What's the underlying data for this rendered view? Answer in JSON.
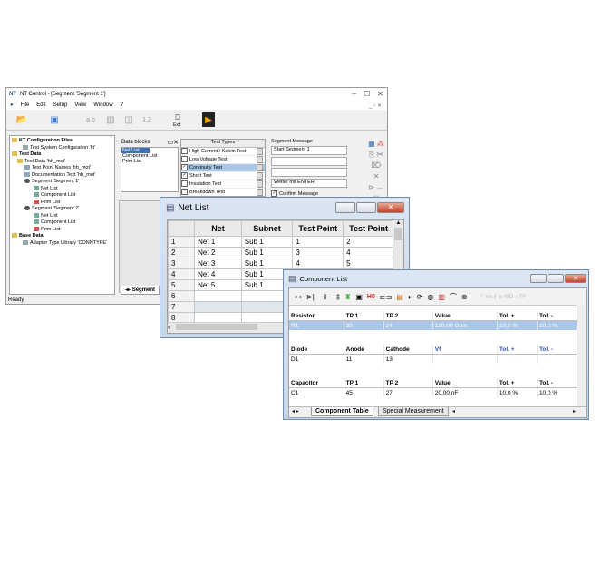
{
  "main_window": {
    "title": "NT Control - [Segment 'Segment 1']",
    "menu": [
      "File",
      "Edit",
      "Setup",
      "View",
      "Window",
      "?"
    ],
    "toolbar": {
      "exit_label": "Exit",
      "page_label": "1.2"
    },
    "tree": {
      "config_files": "KT Configuration Files",
      "test_system": "Test System Configuration 'kt'",
      "test_data": "Test Data",
      "test_data_file": "Test Data 'hh_mot'",
      "tp_names": "Test Point Names 'hh_mot'",
      "doc_text": "Documentation Text 'hh_mot'",
      "segment1": "Segment 'Segment 1'",
      "net_list": "Net List",
      "component_list": "Component List",
      "prim_list": "Prim List",
      "segment2": "Segment 'Segment 2'",
      "net_list2": "Net List",
      "component_list2": "Component List",
      "prim_list2": "Prim List",
      "base_data": "Base Data",
      "adapter": "Adapter Type Library 'CONNTYPE'"
    },
    "data_blocks": {
      "label": "Data blocks",
      "items": [
        "Net List",
        "Component List",
        "Prim List"
      ]
    },
    "test_types": {
      "header": "Test Types",
      "items": [
        {
          "label": "High Current / Kelvin Test",
          "checked": false
        },
        {
          "label": "Low Voltage Test",
          "checked": false
        },
        {
          "label": "Continuity Test",
          "checked": true
        },
        {
          "label": "Short Test",
          "checked": true
        },
        {
          "label": "Insulation Test",
          "checked": false
        },
        {
          "label": "Breakdown Test",
          "checked": false
        }
      ]
    },
    "segment_message": {
      "label": "Segment Message",
      "line1": "Start Segment 1",
      "line4": "Weiter mit ENTER",
      "confirm": "Confirm Message"
    },
    "segment_tab": "Segment",
    "status": "Ready"
  },
  "net_list": {
    "title": "Net List",
    "columns": [
      "Net",
      "Subnet",
      "Test Point",
      "Test Point"
    ],
    "rows": [
      [
        "1",
        "Net 1",
        "Sub 1",
        "1",
        "2"
      ],
      [
        "2",
        "Net 2",
        "Sub 1",
        "3",
        "4"
      ],
      [
        "3",
        "Net 3",
        "Sub 1",
        "4",
        "5"
      ],
      [
        "4",
        "Net 4",
        "Sub 1",
        "",
        ""
      ],
      [
        "5",
        "Net 5",
        "Sub 1",
        "",
        ""
      ],
      [
        "6",
        "",
        "",
        "",
        ""
      ],
      [
        "7",
        "",
        "",
        "",
        ""
      ],
      [
        "8",
        "",
        "",
        "",
        ""
      ]
    ]
  },
  "component_list": {
    "title": "Component List",
    "toolbar_label": "H0",
    "resistor_header": [
      "Resistor",
      "TP 1",
      "TP 2",
      "Value",
      "Tol. +",
      "Tol. -"
    ],
    "resistor_row": [
      "R1",
      "35",
      "24",
      "120,00 Ohm",
      "10,0 %",
      "10,0 %"
    ],
    "diode_header": [
      "Diode",
      "Anode",
      "Cathode",
      "Vf",
      "Tol. +",
      "Tol. -"
    ],
    "diode_row": [
      "D1",
      "11",
      "13",
      "",
      "",
      ""
    ],
    "capacitor_header": [
      "Capacitor",
      "TP 1",
      "TP 2",
      "Value",
      "Tol. +",
      "Tol. -"
    ],
    "capacitor_row": [
      "C1",
      "45",
      "27",
      "20,00 nF",
      "10,0 %",
      "10,0 %"
    ],
    "tabs": [
      "Component Table",
      "Special Measurement"
    ]
  }
}
